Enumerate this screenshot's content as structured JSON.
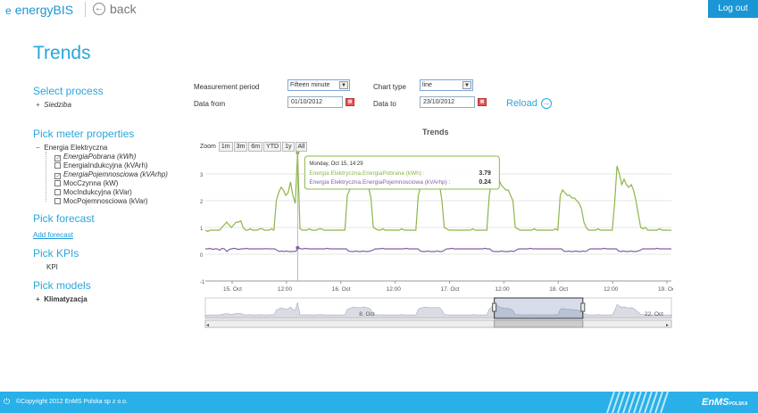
{
  "header": {
    "brand": "energyBIS",
    "brand_icon": "e",
    "back_label": "back",
    "logout_label": "Log out"
  },
  "page_title": "Trends",
  "sidebar": {
    "select_process": {
      "title": "Select process",
      "items": [
        {
          "label": "Siedziba",
          "expand": "+"
        }
      ]
    },
    "pick_meter": {
      "title": "Pick meter properties",
      "root": "Energia Elektryczna",
      "root_expand": "−",
      "items": [
        {
          "label": "EnergiaPobrana (kWh)",
          "checked": true
        },
        {
          "label": "EnergiaIndukcyjna (kVArh)",
          "checked": false
        },
        {
          "label": "EnergiaPojemnosciowa (kVArhp)",
          "checked": true
        },
        {
          "label": "MocCzynna (kW)",
          "checked": false
        },
        {
          "label": "MocIndukcyjna (kVar)",
          "checked": false
        },
        {
          "label": "MocPojemnosciowa (kVar)",
          "checked": false
        }
      ]
    },
    "pick_forecast": {
      "title": "Pick forecast",
      "link": "Add forecast"
    },
    "pick_kpis": {
      "title": "Pick KPIs",
      "items": [
        {
          "label": "KPI"
        }
      ]
    },
    "pick_models": {
      "title": "Pick models",
      "items": [
        {
          "label": "Klimatyzacja",
          "expand": "+"
        }
      ]
    }
  },
  "controls": {
    "period_label": "Measurement period",
    "period_value": "Fifteen minute",
    "chart_type_label": "Chart type",
    "chart_type_value": "line",
    "date_from_label": "Data from",
    "date_from_value": "01/10/2012",
    "date_to_label": "Data to",
    "date_to_value": "23/10/2012",
    "reload_label": "Reload"
  },
  "chart_data": {
    "type": "line",
    "title": "Trends",
    "zoom_label": "Zoom",
    "zoom_buttons": [
      "1m",
      "3m",
      "6m",
      "YTD",
      "1y",
      "All"
    ],
    "x_ticks": [
      "15. Oct",
      "12:00",
      "16. Oct",
      "12:00",
      "17. Oct",
      "12:00",
      "18. Oct",
      "12:00",
      "19. Oc"
    ],
    "y_ticks": [
      "3",
      "2",
      "1",
      "0",
      "-1"
    ],
    "ylim": [
      -1,
      3.5
    ],
    "series": [
      {
        "name": "Energia Elektryczna.EnergiaPobrana (kWh)",
        "color": "#8db54a",
        "values": [
          0.9,
          0.85,
          0.9,
          0.9,
          0.9,
          0.9,
          0.9,
          1.0,
          1.1,
          1.2,
          1.1,
          1.0,
          1.1,
          1.2,
          1.2,
          1.25,
          1.0,
          0.9,
          0.9,
          0.95,
          0.9,
          0.9,
          0.9,
          0.95,
          0.95,
          0.9,
          0.9,
          0.9,
          0.95,
          0.9,
          2.0,
          2.3,
          2.5,
          2.4,
          2.2,
          2.3,
          2.7,
          2.2,
          1.9,
          3.79,
          0.95,
          0.9,
          0.9,
          0.9,
          0.95,
          0.9,
          0.9,
          0.9,
          0.95,
          0.95,
          0.9,
          0.9,
          0.9,
          0.9,
          0.9,
          0.9,
          0.9,
          0.9,
          0.9,
          0.9,
          2.2,
          2.4,
          2.6,
          2.7,
          2.6,
          2.6,
          2.6,
          2.7,
          2.6,
          2.5,
          2.1,
          1.0,
          0.95,
          0.9,
          0.9,
          0.95,
          0.9,
          0.9,
          0.9,
          0.9,
          0.9,
          0.9,
          0.9,
          0.95,
          0.9,
          0.9,
          0.9,
          0.9,
          0.9,
          0.9,
          2.2,
          2.5,
          2.6,
          2.7,
          2.6,
          2.6,
          2.6,
          2.6,
          2.6,
          2.6,
          2.0,
          1.0,
          0.95,
          0.9,
          0.9,
          0.9,
          0.9,
          0.9,
          0.9,
          0.9,
          0.9,
          0.9,
          0.9,
          0.95,
          0.9,
          0.9,
          0.9,
          0.9,
          0.9,
          0.9,
          2.2,
          2.7,
          3.0,
          3.3,
          2.8,
          2.6,
          2.5,
          2.4,
          2.4,
          2.2,
          2.0,
          1.0,
          0.95,
          0.9,
          0.9,
          0.9,
          0.9,
          0.9,
          0.9,
          0.95,
          0.9,
          0.9,
          0.9,
          0.9,
          0.9,
          0.9,
          0.9,
          0.9,
          0.95,
          0.9,
          2.2,
          2.4,
          2.3,
          2.2,
          2.2,
          2.1,
          2.1,
          2.0,
          1.9,
          1.7,
          1.2,
          1.0,
          0.9,
          0.9,
          0.9,
          0.9,
          0.95,
          0.9,
          0.9,
          0.9,
          0.9,
          0.9,
          0.9,
          1.9,
          3.3,
          3.0,
          2.6,
          2.8,
          2.6,
          2.5,
          2.6,
          2.4,
          2.0,
          1.5,
          1.0,
          0.95,
          1.0,
          0.9,
          0.9,
          0.9,
          0.9,
          0.9,
          0.95,
          0.9,
          0.9,
          0.9,
          0.9,
          0.9
        ]
      },
      {
        "name": "Energia Elektryczna.EnergiaPojemnosciowa (kVArhp)",
        "color": "#8064a2",
        "values": [
          0.2,
          0.2,
          0.22,
          0.18,
          0.2,
          0.2,
          0.15,
          0.22,
          0.2,
          0.1,
          0.18,
          0.2,
          0.22,
          0.2,
          0.18,
          0.2,
          0.2,
          0.22,
          0.2,
          0.2,
          0.2,
          0.2,
          0.2,
          0.2,
          0.2,
          0.21,
          0.2,
          0.2,
          0.2,
          0.2,
          0.15,
          0.1,
          0.12,
          0.1,
          0.12,
          0.1,
          0.1,
          0.1,
          0.12,
          0.24,
          0.2,
          0.2,
          0.22,
          0.2,
          0.2,
          0.2,
          0.2,
          0.2,
          0.2,
          0.2,
          0.2,
          0.22,
          0.2,
          0.2,
          0.2,
          0.2,
          0.2,
          0.2,
          0.2,
          0.2,
          0.12,
          0.1,
          0.1,
          0.12,
          0.1,
          0.1,
          0.12,
          0.1,
          0.1,
          0.12,
          0.15,
          0.2,
          0.2,
          0.2,
          0.22,
          0.2,
          0.2,
          0.2,
          0.2,
          0.2,
          0.2,
          0.2,
          0.2,
          0.2,
          0.22,
          0.2,
          0.2,
          0.2,
          0.2,
          0.2,
          0.12,
          0.1,
          0.1,
          0.12,
          0.1,
          0.1,
          0.1,
          0.12,
          0.1,
          0.1,
          0.15,
          0.2,
          0.2,
          0.22,
          0.2,
          0.2,
          0.2,
          0.2,
          0.2,
          0.2,
          0.2,
          0.2,
          0.2,
          0.2,
          0.2,
          0.2,
          0.2,
          0.22,
          0.2,
          0.2,
          0.12,
          0.1,
          0.1,
          0.1,
          0.12,
          0.1,
          0.1,
          0.1,
          0.12,
          0.1,
          0.15,
          0.2,
          0.2,
          0.2,
          0.2,
          0.2,
          0.22,
          0.2,
          0.2,
          0.2,
          0.2,
          0.2,
          0.2,
          0.2,
          0.2,
          0.2,
          0.2,
          0.2,
          0.2,
          0.2,
          0.12,
          0.1,
          0.12,
          0.1,
          0.1,
          0.12,
          0.1,
          0.1,
          0.12,
          0.1,
          0.15,
          0.2,
          0.2,
          0.2,
          0.2,
          0.2,
          0.2,
          0.22,
          0.2,
          0.2,
          0.2,
          0.2,
          0.2,
          0.12,
          0.1,
          0.12,
          0.1,
          0.1,
          0.12,
          0.1,
          0.1,
          0.12,
          0.15,
          0.2,
          0.2,
          0.2,
          0.2,
          0.2,
          0.2,
          0.22,
          0.2,
          0.2,
          0.2,
          0.2,
          0.2,
          0.2
        ]
      }
    ],
    "tooltip": {
      "date": "Monday, Oct 15, 14:29",
      "rows": [
        {
          "name": "Energia Elektryczna.EnergiaPobrana (kWh)",
          "value": "3.79"
        },
        {
          "name": "Energia Elektryczna.EnergiaPojemnosciowa (kVArhp)",
          "value": "0.24"
        }
      ]
    },
    "tooltip_index": 39,
    "navigator": {
      "labels": [
        "8. Oct",
        "22. Oct"
      ],
      "selected_from": 0.62,
      "selected_to": 0.81
    }
  },
  "footer": {
    "icon": "⏻",
    "copyright": "©Copyright 2012 EnMS Polska sp z o.o.",
    "logo": "EnMS",
    "logo_sub": "POLSKA"
  }
}
